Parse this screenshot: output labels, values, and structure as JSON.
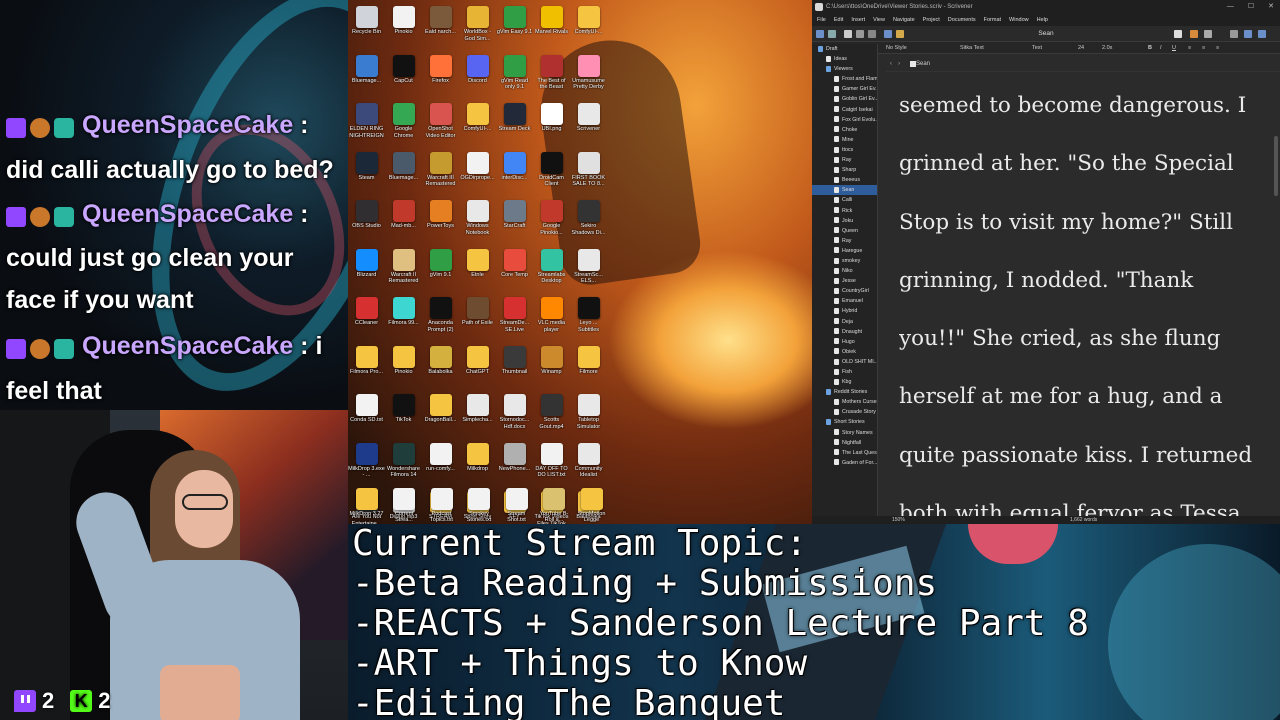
{
  "chat": {
    "messages": [
      {
        "user": "QueenSpaceCake",
        "text": "did calli actually go to bed?"
      },
      {
        "user": "QueenSpaceCake",
        "text": "could just go clean your face if you want"
      },
      {
        "user": "QueenSpaceCake",
        "text": "i feel that"
      }
    ]
  },
  "counters": {
    "twitch": "2",
    "kick": "2",
    "kick_letter": "K"
  },
  "desktop": {
    "icons": [
      {
        "label": "Recycle Bin",
        "color": "#d0d4da"
      },
      {
        "label": "Pinokio",
        "color": "#f2f2f2"
      },
      {
        "label": "Eald narch...",
        "color": "#7a5a3a"
      },
      {
        "label": "WorldBox - God Sim...",
        "color": "#e7b533"
      },
      {
        "label": "gVim Easy 9.1",
        "color": "#2f9e44"
      },
      {
        "label": "Marvel Rivals",
        "color": "#f0c000"
      },
      {
        "label": "ComfyUI-...",
        "color": "#f5c542"
      },
      {
        "label": "Bluemage...",
        "color": "#3a7ccf"
      },
      {
        "label": "CapCut",
        "color": "#111111"
      },
      {
        "label": "Firefox",
        "color": "#ff7139"
      },
      {
        "label": "Discord",
        "color": "#5865f2"
      },
      {
        "label": "gVim Read only 9.1",
        "color": "#2f9e44"
      },
      {
        "label": "The Best of the Beast",
        "color": "#b03030"
      },
      {
        "label": "Umamusume Pretty Derby",
        "color": "#ff8fb3"
      },
      {
        "label": "ELDEN RING NIGHTREIGN",
        "color": "#3b4a7a"
      },
      {
        "label": "Google Chrome",
        "color": "#34a853"
      },
      {
        "label": "OpenShot Video Editor",
        "color": "#d9534f"
      },
      {
        "label": "ComfyUI-...",
        "color": "#f5c542"
      },
      {
        "label": "Stream Deck",
        "color": "#222a3a"
      },
      {
        "label": "UBI.png",
        "color": "#ffffff"
      },
      {
        "label": "Scrivener",
        "color": "#e8e8e8"
      },
      {
        "label": "Steam",
        "color": "#1b2838"
      },
      {
        "label": "Bluemage...",
        "color": "#4a5a6a"
      },
      {
        "label": "Warcraft III Remastered",
        "color": "#c59a2e"
      },
      {
        "label": "OGDirprope...",
        "color": "#f2f2f2"
      },
      {
        "label": "interDisc...",
        "color": "#4285f4"
      },
      {
        "label": "DroidCam Client",
        "color": "#111111"
      },
      {
        "label": "FIRST BOOK SALE TO 8...",
        "color": "#e0e0e0"
      },
      {
        "label": "OBS Studio",
        "color": "#302e31"
      },
      {
        "label": "Mad-mb...",
        "color": "#c0392b"
      },
      {
        "label": "PowerToys",
        "color": "#e67e22"
      },
      {
        "label": "Windows Notebook",
        "color": "#e8e8e8"
      },
      {
        "label": "StarCraft",
        "color": "#6c7a89"
      },
      {
        "label": "Google Pinokio...",
        "color": "#c0392b"
      },
      {
        "label": "Sekiro Shadows Di...",
        "color": "#333333"
      },
      {
        "label": "Blizzard",
        "color": "#148eff"
      },
      {
        "label": "Warcraft II Remastered",
        "color": "#e0c080"
      },
      {
        "label": "gVim 9.1",
        "color": "#2f9e44"
      },
      {
        "label": "Etnle",
        "color": "#f5c542"
      },
      {
        "label": "Core Temp",
        "color": "#e74c3c"
      },
      {
        "label": "Streamlabs Desktop",
        "color": "#31c3a2"
      },
      {
        "label": "StreamSc... ELS...",
        "color": "#e8e8e8"
      },
      {
        "label": "CCleaner",
        "color": "#d63031"
      },
      {
        "label": "Filmora 99...",
        "color": "#3dd6d0"
      },
      {
        "label": "Anaconda Prompt (2)",
        "color": "#111111"
      },
      {
        "label": "Path of Exile",
        "color": "#6d4c2f"
      },
      {
        "label": "StreamDe... SE.Live",
        "color": "#d63031"
      },
      {
        "label": "VLC media player",
        "color": "#ff8800"
      },
      {
        "label": "Leyo ... Subtitles",
        "color": "#111111"
      },
      {
        "label": "Filmora Pro...",
        "color": "#f5c542"
      },
      {
        "label": "Pinokio",
        "color": "#f5c542"
      },
      {
        "label": "Balabolka",
        "color": "#d4b13f"
      },
      {
        "label": "ChatGPT",
        "color": "#f5c542"
      },
      {
        "label": "Thumbnail",
        "color": "#3a3a3a"
      },
      {
        "label": "Winamp",
        "color": "#cc8a2d"
      },
      {
        "label": "Filmore",
        "color": "#f5c542"
      },
      {
        "label": "Conda SD.txt",
        "color": "#f2f2f2"
      },
      {
        "label": "TikTok",
        "color": "#111111"
      },
      {
        "label": "DragonBall...",
        "color": "#f5c542"
      },
      {
        "label": "Simplecha...",
        "color": "#e8e8e8"
      },
      {
        "label": "Stornodoc... Hdf.docx",
        "color": "#e8e8e8"
      },
      {
        "label": "Scotts Gout.mp4",
        "color": "#333333"
      },
      {
        "label": "Tabletop Simulator",
        "color": "#e8e8e8"
      },
      {
        "label": "MilkDrop 3.exe - ...",
        "color": "#1e3a8a"
      },
      {
        "label": "Wondershare Filmora 14",
        "color": "#1f3d3a"
      },
      {
        "label": "run-comfy...",
        "color": "#f2f2f2"
      },
      {
        "label": "Milkdrop",
        "color": "#f5c542"
      },
      {
        "label": "NewPhone...",
        "color": "#b0b0b0"
      },
      {
        "label": "DAY OFF TO DO LIST.txt",
        "color": "#f2f2f2"
      },
      {
        "label": "Community Idealist",
        "color": "#e8e8e8"
      },
      {
        "label": "Are You Not Entertaine...",
        "color": "#333333"
      },
      {
        "label": "Dialup.mp3",
        "color": "#e8e8e8"
      },
      {
        "label": "STREAM",
        "color": "#f5c542"
      },
      {
        "label": "Short Story",
        "color": "#f5c542"
      },
      {
        "label": "FFY",
        "color": "#f5c542"
      },
      {
        "label": "TikTok Videos Files TikTok",
        "color": "#f5c542"
      },
      {
        "label": "Balabolka",
        "color": "#f5c542"
      },
      {
        "label": "MilkDrop 3.27",
        "color": "#f5c542"
      },
      {
        "label": "Current Strea...",
        "color": "#f2f2f2"
      },
      {
        "label": "Podcast Topics.txt",
        "color": "#f2f2f2"
      },
      {
        "label": "Smokey Stories.txt",
        "color": "#f2f2f2"
      },
      {
        "label": "Stream Shot.txt",
        "color": "#f2f2f2"
      },
      {
        "label": "YouTube B-Roll a...",
        "color": "#d9c170"
      },
      {
        "label": "StopMotion Legge",
        "color": "#f5c542"
      }
    ]
  },
  "scrivener": {
    "title": "C:\\Users\\ttos\\OneDrive\\Viewer Stories.scriv - Scrivener",
    "menu": [
      "File",
      "Edit",
      "Insert",
      "View",
      "Navigate",
      "Project",
      "Documents",
      "Format",
      "Window",
      "Help"
    ],
    "doc_title": "Sean",
    "format": {
      "style": "No Style",
      "font": "Sitka Text",
      "face": "Text",
      "size": "24",
      "spacing": "2.0x"
    },
    "binder": [
      {
        "label": "Draft",
        "level": 0,
        "folder": true
      },
      {
        "label": "Ideas",
        "level": 1,
        "folder": false
      },
      {
        "label": "Viewers",
        "level": 1,
        "folder": true
      },
      {
        "label": "Frost and Flame",
        "level": 2,
        "folder": false
      },
      {
        "label": "Gamer Girl Ev...",
        "level": 2,
        "folder": false
      },
      {
        "label": "Goblin Girl Ev...",
        "level": 2,
        "folder": false
      },
      {
        "label": "Catgirl Isekai",
        "level": 2,
        "folder": false
      },
      {
        "label": "Fox Girl Evolu...",
        "level": 2,
        "folder": false
      },
      {
        "label": "Choke",
        "level": 2,
        "folder": false
      },
      {
        "label": "Mine",
        "level": 2,
        "folder": false
      },
      {
        "label": "ttocs",
        "level": 2,
        "folder": false
      },
      {
        "label": "Ray",
        "level": 2,
        "folder": false
      },
      {
        "label": "Sharp",
        "level": 2,
        "folder": false
      },
      {
        "label": "Beeeus",
        "level": 2,
        "folder": false
      },
      {
        "label": "Sean",
        "level": 2,
        "folder": false,
        "selected": true
      },
      {
        "label": "Calli",
        "level": 2,
        "folder": false
      },
      {
        "label": "Rick",
        "level": 2,
        "folder": false
      },
      {
        "label": "Joku",
        "level": 2,
        "folder": false
      },
      {
        "label": "Queen",
        "level": 2,
        "folder": false
      },
      {
        "label": "Ray",
        "level": 2,
        "folder": false
      },
      {
        "label": "Haregue",
        "level": 2,
        "folder": false
      },
      {
        "label": "smokey",
        "level": 2,
        "folder": false
      },
      {
        "label": "Niko",
        "level": 2,
        "folder": false
      },
      {
        "label": "Jesse",
        "level": 2,
        "folder": false
      },
      {
        "label": "CountryGirl",
        "level": 2,
        "folder": false
      },
      {
        "label": "Emanuel",
        "level": 2,
        "folder": false
      },
      {
        "label": "Hybrid",
        "level": 2,
        "folder": false
      },
      {
        "label": "Deja",
        "level": 2,
        "folder": false
      },
      {
        "label": "Dnaught",
        "level": 2,
        "folder": false
      },
      {
        "label": "Hugo",
        "level": 2,
        "folder": false
      },
      {
        "label": "Obiek",
        "level": 2,
        "folder": false
      },
      {
        "label": "OLD SHIT MI...",
        "level": 2,
        "folder": false
      },
      {
        "label": "Fish",
        "level": 2,
        "folder": false
      },
      {
        "label": "Kbg",
        "level": 2,
        "folder": false
      },
      {
        "label": "Reddit Stories",
        "level": 1,
        "folder": true
      },
      {
        "label": "Mothers Curse",
        "level": 2,
        "folder": false
      },
      {
        "label": "Crusade Story",
        "level": 2,
        "folder": false
      },
      {
        "label": "Short Stories",
        "level": 1,
        "folder": true
      },
      {
        "label": "Story Names",
        "level": 2,
        "folder": false
      },
      {
        "label": "Nightfall",
        "level": 2,
        "folder": false
      },
      {
        "label": "The Last Ques...",
        "level": 2,
        "folder": false
      },
      {
        "label": "Gaden of For...",
        "level": 2,
        "folder": false
      }
    ],
    "editor_lines": [
      "seemed to become dangerous. I",
      "grinned at her. \"So the Special",
      "Stop is to visit my home?\" Still",
      "grinning, I nodded. \"Thank",
      "you!!\" She cried, as she flung",
      "herself at me for a hug, and a",
      "quite passionate kiss. I returned",
      "both with equal fervor as Tessa"
    ],
    "zoom": "150%",
    "word_count": "1,662 words"
  },
  "topic": {
    "lines": [
      "Current Stream Topic:",
      "-Beta Reading + Submissions",
      "-REACTS + Sanderson Lecture Part 8",
      "-ART + Things to Know",
      "-Editing The Banquet"
    ]
  }
}
